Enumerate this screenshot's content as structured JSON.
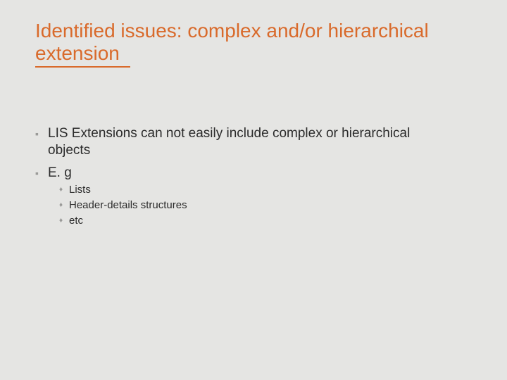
{
  "slide": {
    "title": "Identified issues: complex and/or hierarchical extension",
    "bullets": [
      {
        "text": "LIS Extensions can not easily include complex or hierarchical objects"
      },
      {
        "text": "E. g",
        "sub": [
          {
            "text": "Lists"
          },
          {
            "text": "Header-details structures"
          },
          {
            "text": "etc"
          }
        ]
      }
    ]
  }
}
